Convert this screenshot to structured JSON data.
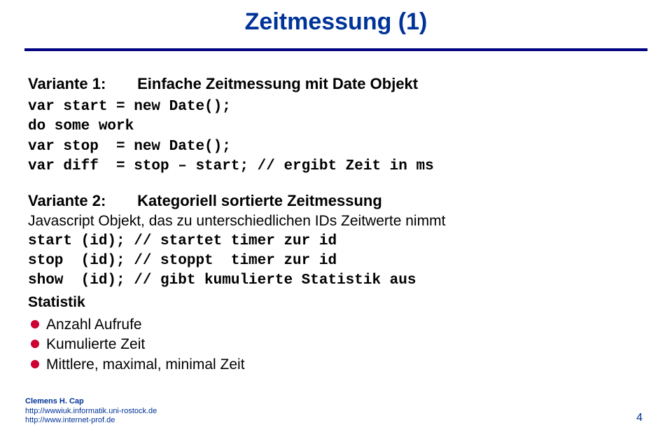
{
  "title": "Zeitmessung (1)",
  "variant1": {
    "label": "Variante 1:",
    "desc": "Einfache Zeitmessung mit Date Objekt",
    "code": "var start = new Date();\ndo some work\nvar stop  = new Date();\nvar diff  = stop – start; // ergibt Zeit in ms"
  },
  "variant2": {
    "label": "Variante 2:",
    "desc": "Kategoriell sortierte Zeitmessung",
    "body": "Javascript Objekt, das zu unterschiedlichen IDs Zeitwerte nimmt",
    "code": "start (id); // startet timer zur id\nstop  (id); // stoppt  timer zur id\nshow  (id); // gibt kumulierte Statistik aus"
  },
  "stats": {
    "heading": "Statistik",
    "items": [
      "Anzahl Aufrufe",
      "Kumulierte Zeit",
      "Mittlere, maximal, minimal Zeit"
    ]
  },
  "footer": {
    "name": "Clemens H. Cap",
    "link1": "http://wwwiuk.informatik.uni-rostock.de",
    "link2": "http://www.internet-prof.de"
  },
  "pagenum": "4"
}
